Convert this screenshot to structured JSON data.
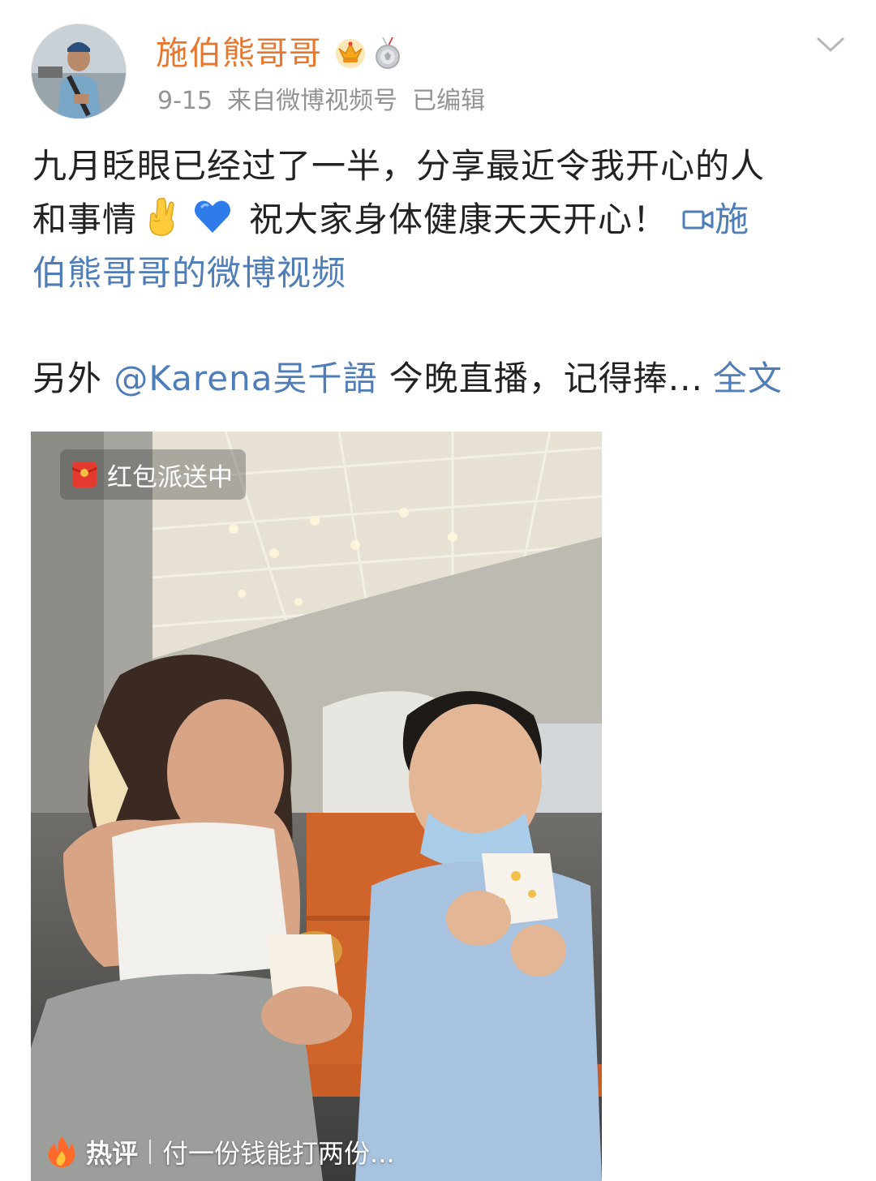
{
  "post": {
    "author": "施伯熊哥哥",
    "date": "9-15",
    "source_prefix": "来自",
    "source_name": "微博视频号",
    "edited": "已编辑",
    "badges": [
      "crown-badge-icon",
      "medal-badge-icon"
    ],
    "text_line1": "九月眨眼已经过了一半，分享最近令我开心的人",
    "text_line2_start": "和事情",
    "emoji1": "hand-gesture-emoji",
    "emoji2": "blue-heart-emoji",
    "text_line2_mid": "祝大家身体健康天天开心！",
    "video_link_part1": "施",
    "video_link_part2": "伯熊哥哥的微博视频",
    "more_prefix": "另外 ",
    "mention": "@Karena吴千語",
    "more_text": " 今晚直播，记得捧...",
    "full_text_link": "全文"
  },
  "video": {
    "redpacket_label": "红包派送中",
    "hot_label": "热评",
    "hot_comment": "付一份钱能打两份..."
  },
  "colors": {
    "username": "#e8772e",
    "link": "#4e7db8",
    "meta": "#939393"
  }
}
